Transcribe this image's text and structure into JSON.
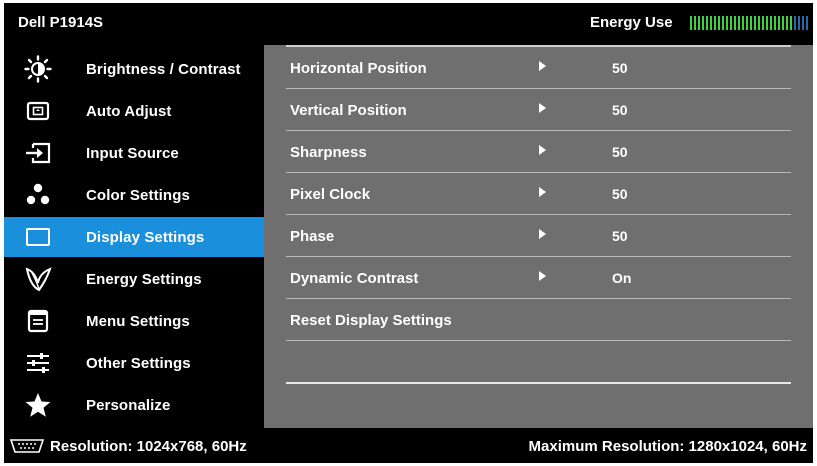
{
  "header": {
    "model": "Dell P1914S",
    "energy_label": "Energy Use",
    "energy_level": 0.88,
    "colors": {
      "meter_on": "#3fd23f",
      "meter_off": "#2a6aa8"
    }
  },
  "sidebar": {
    "active_color": "#1a8fdc",
    "items": [
      {
        "label": "Brightness / Contrast",
        "icon": "brightness-icon"
      },
      {
        "label": "Auto Adjust",
        "icon": "auto-adjust-icon"
      },
      {
        "label": "Input Source",
        "icon": "input-source-icon"
      },
      {
        "label": "Color Settings",
        "icon": "color-settings-icon"
      },
      {
        "label": "Display Settings",
        "icon": "display-settings-icon",
        "active": true
      },
      {
        "label": "Energy Settings",
        "icon": "energy-leaf-icon"
      },
      {
        "label": "Menu Settings",
        "icon": "menu-settings-icon"
      },
      {
        "label": "Other Settings",
        "icon": "other-settings-icon"
      },
      {
        "label": "Personalize",
        "icon": "star-icon"
      }
    ]
  },
  "panel": {
    "rows": [
      {
        "label": "Horizontal Position",
        "value": "50"
      },
      {
        "label": "Vertical Position",
        "value": "50"
      },
      {
        "label": "Sharpness",
        "value": "50"
      },
      {
        "label": "Pixel Clock",
        "value": "50"
      },
      {
        "label": "Phase",
        "value": "50"
      },
      {
        "label": "Dynamic Contrast",
        "value": "On"
      },
      {
        "label": "Reset Display Settings",
        "value": ""
      }
    ]
  },
  "footer": {
    "resolution": "Resolution: 1024x768,  60Hz",
    "max_resolution": "Maximum Resolution: 1280x1024,  60Hz"
  }
}
